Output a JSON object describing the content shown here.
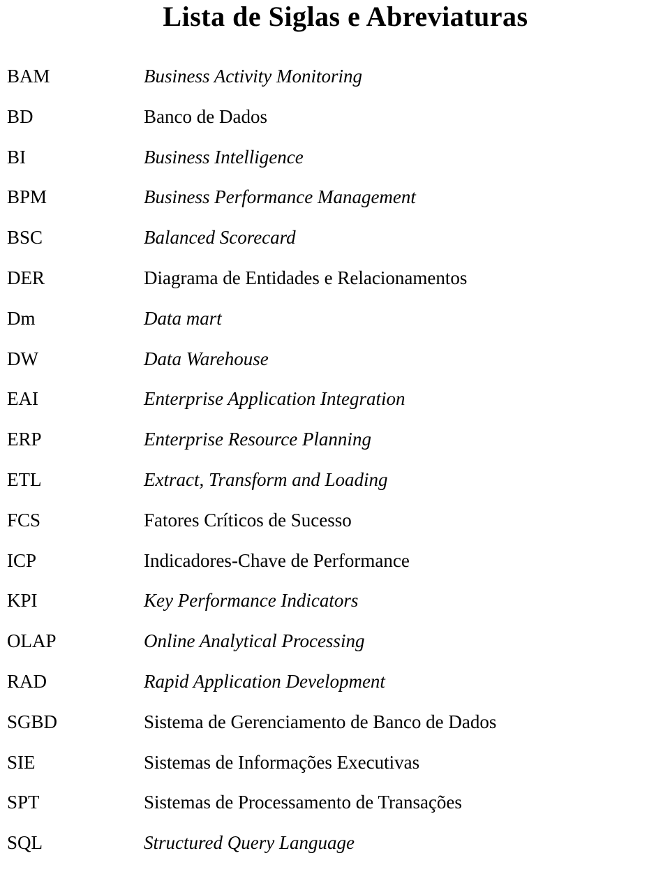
{
  "document": {
    "title": "Lista de Siglas e Abreviaturas",
    "entries": [
      {
        "term": "BAM",
        "definition": "Business Activity Monitoring",
        "style": "italic"
      },
      {
        "term": "BD",
        "definition": "Banco de Dados",
        "style": "roman"
      },
      {
        "term": "BI",
        "definition": "Business Intelligence",
        "style": "italic"
      },
      {
        "term": "BPM",
        "definition": "Business Performance Management",
        "style": "italic"
      },
      {
        "term": "BSC",
        "definition": "Balanced Scorecard",
        "style": "italic"
      },
      {
        "term": "DER",
        "definition": "Diagrama de Entidades e Relacionamentos",
        "style": "roman"
      },
      {
        "term": "Dm",
        "definition": "Data mart",
        "style": "italic"
      },
      {
        "term": "DW",
        "definition": "Data Warehouse",
        "style": "italic"
      },
      {
        "term": "EAI",
        "definition": "Enterprise Application Integration",
        "style": "italic"
      },
      {
        "term": "ERP",
        "definition": "Enterprise Resource Planning",
        "style": "italic"
      },
      {
        "term": "ETL",
        "definition": "Extract, Transform and Loading",
        "style": "italic"
      },
      {
        "term": "FCS",
        "definition": "Fatores Críticos de Sucesso",
        "style": "roman"
      },
      {
        "term": "ICP",
        "definition": "Indicadores-Chave de Performance",
        "style": "roman"
      },
      {
        "term": "KPI",
        "definition": "Key Performance Indicators",
        "style": "italic"
      },
      {
        "term": "OLAP",
        "definition": "Online Analytical Processing",
        "style": "italic"
      },
      {
        "term": "RAD",
        "definition": "Rapid Application Development",
        "style": "italic"
      },
      {
        "term": "SGBD",
        "definition": "Sistema de Gerenciamento de Banco de Dados",
        "style": "roman"
      },
      {
        "term": "SIE",
        "definition": "Sistemas de Informações Executivas",
        "style": "roman"
      },
      {
        "term": "SPT",
        "definition": "Sistemas de Processamento de Transações",
        "style": "roman"
      },
      {
        "term": "SQL",
        "definition": "Structured Query Language",
        "style": "italic"
      }
    ]
  }
}
